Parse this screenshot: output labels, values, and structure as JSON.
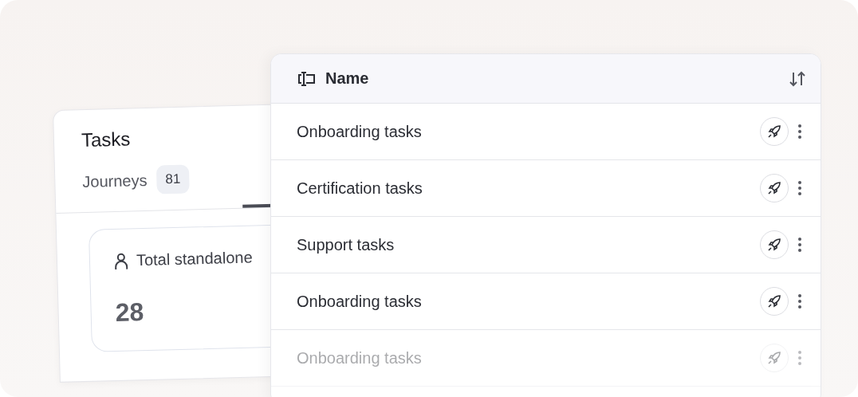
{
  "tasks_panel": {
    "title": "Tasks",
    "tabs": [
      {
        "label": "Journeys",
        "count": "81",
        "selected": false
      }
    ],
    "stat": {
      "label": "Total standalone",
      "value": "28"
    }
  },
  "table": {
    "column": {
      "label": "Name"
    },
    "rows": [
      {
        "name": "Onboarding tasks",
        "faded": false
      },
      {
        "name": "Certification tasks",
        "faded": false
      },
      {
        "name": "Support tasks",
        "faded": false
      },
      {
        "name": "Onboarding tasks",
        "faded": false
      },
      {
        "name": "Onboarding tasks",
        "faded": true
      }
    ]
  }
}
